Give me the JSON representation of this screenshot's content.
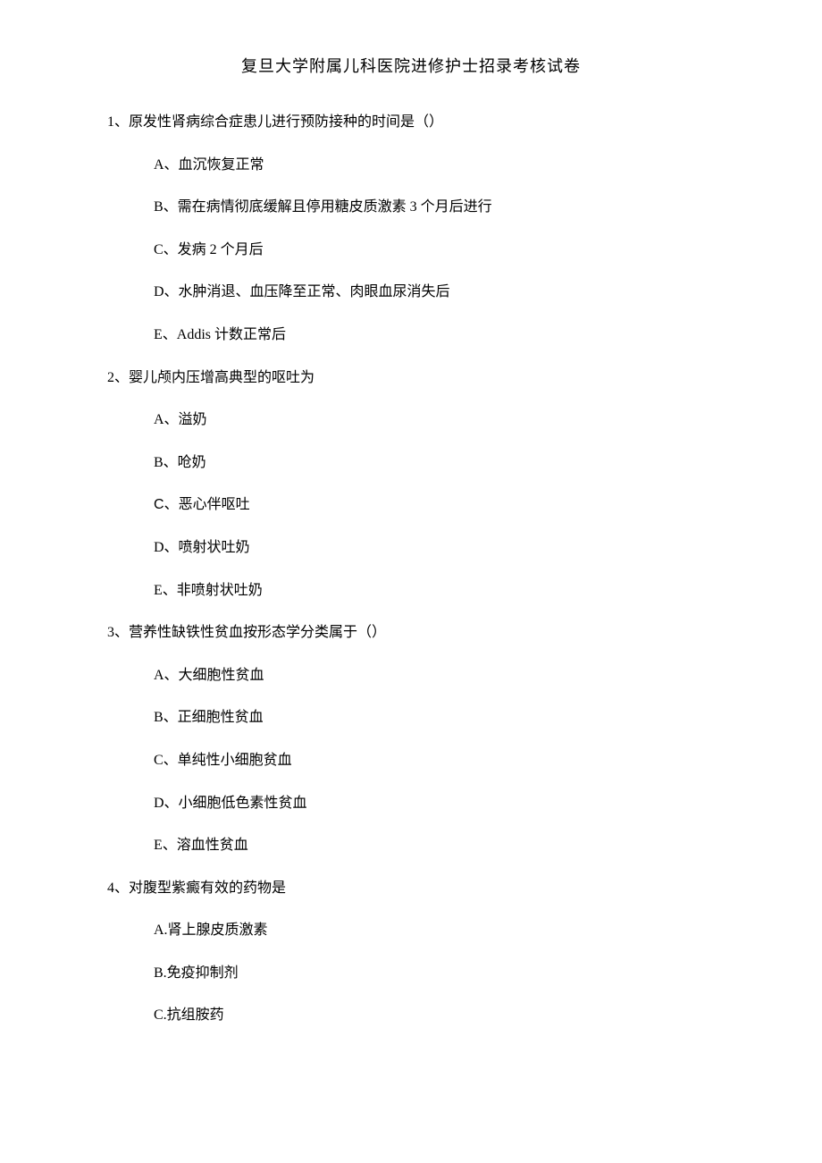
{
  "title": "复旦大学附属儿科医院进修护士招录考核试卷",
  "questions": [
    {
      "number": "1、",
      "stem": "原发性肾病综合症患儿进行预防接种的时间是（）",
      "options": [
        {
          "label": "A、",
          "text": "血沉恢复正常"
        },
        {
          "label": "B、",
          "text": "需在病情彻底缓解且停用糖皮质激素 3 个月后进行"
        },
        {
          "label": "C、",
          "text": "发病 2 个月后"
        },
        {
          "label": "D、",
          "text": "水肿消退、血压降至正常、肉眼血尿消失后"
        },
        {
          "label": "E、",
          "text": "Addis 计数正常后"
        }
      ]
    },
    {
      "number": "2、",
      "stem": "婴儿颅内压增高典型的呕吐为",
      "options": [
        {
          "label": "A、",
          "text": "溢奶"
        },
        {
          "label": "B、",
          "text": "呛奶"
        },
        {
          "label": "C、",
          "text": "恶心伴呕吐",
          "special": true
        },
        {
          "label": "D、",
          "text": "喷射状吐奶"
        },
        {
          "label": "E、",
          "text": "非喷射状吐奶"
        }
      ]
    },
    {
      "number": "3、",
      "stem": "营养性缺铁性贫血按形态学分类属于（）",
      "options": [
        {
          "label": "A、",
          "text": "大细胞性贫血"
        },
        {
          "label": "B、",
          "text": "正细胞性贫血"
        },
        {
          "label": "C、",
          "text": "单纯性小细胞贫血"
        },
        {
          "label": "D、",
          "text": "小细胞低色素性贫血"
        },
        {
          "label": "E、",
          "text": "溶血性贫血"
        }
      ]
    },
    {
      "number": "4、",
      "stem": "对腹型紫癜有效的药物是",
      "options": [
        {
          "label": "A.",
          "text": "肾上腺皮质激素"
        },
        {
          "label": "B.",
          "text": "免疫抑制剂"
        },
        {
          "label": "C.",
          "text": "抗组胺药"
        }
      ]
    }
  ]
}
